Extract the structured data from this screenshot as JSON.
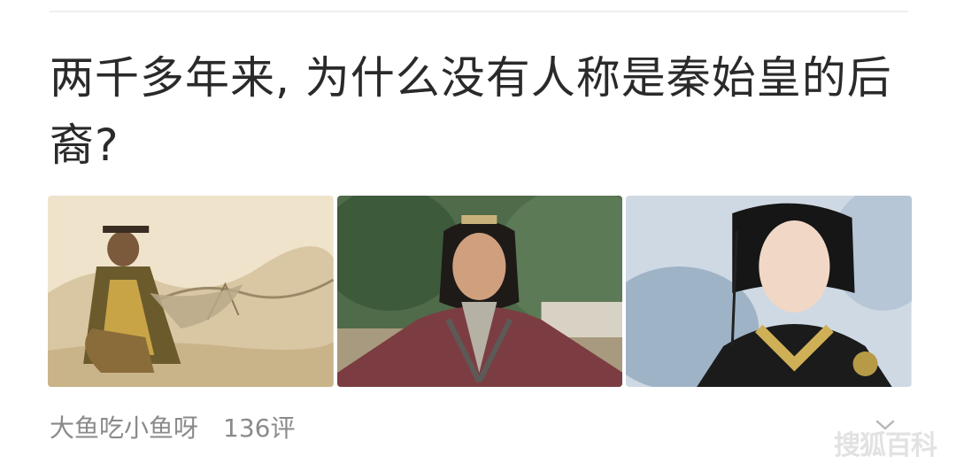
{
  "article": {
    "title": "两千多年来, 为什么没有人称是秦始皇的后裔?",
    "author": "大鱼吃小鱼呀",
    "comments": "136评"
  },
  "images": [
    {
      "subject": "painting of Qin emperor before the Great Wall"
    },
    {
      "subject": "actor in maroon Qin-era robe"
    },
    {
      "subject": "illustration of young man in black robe"
    }
  ],
  "watermark": "搜狐百科",
  "icons": {
    "dismiss": "chevron-down-icon"
  },
  "colors": {
    "title": "#2a2a2a",
    "meta": "#8a8a8a"
  }
}
